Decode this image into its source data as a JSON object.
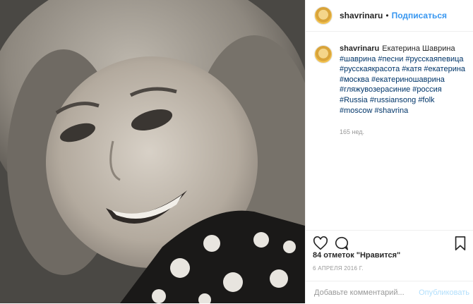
{
  "header": {
    "username": "shavrinaru",
    "separator": "•",
    "follow_label": "Подписаться"
  },
  "caption": {
    "username": "shavrinaru",
    "text": "Екатерина Шаврина",
    "hashtags": [
      "#шаврина",
      "#песни",
      "#русскаяпевица",
      "#русскаякрасота",
      "#катя",
      "#екатерина",
      "#москва",
      "#екатериношаврина",
      "#гляжувозерасиние",
      "#россия",
      "#Russia",
      "#russiansong",
      "#folk",
      "#moscow",
      "#shavrina"
    ],
    "time_ago": "165 нед."
  },
  "actions": {
    "like_icon": "heart-outline",
    "comment_icon": "speech-bubble",
    "save_icon": "bookmark-outline"
  },
  "likes_text": "84 отметок \"Нравится\"",
  "date_text": "6 АПРЕЛЯ 2016 Г.",
  "comment_box": {
    "placeholder": "Добавьте комментарий...",
    "publish_label": "Опубликовать"
  },
  "colors": {
    "link": "#003569",
    "follow": "#3897f0",
    "publish_disabled": "#b2dffc",
    "muted": "#999999"
  }
}
